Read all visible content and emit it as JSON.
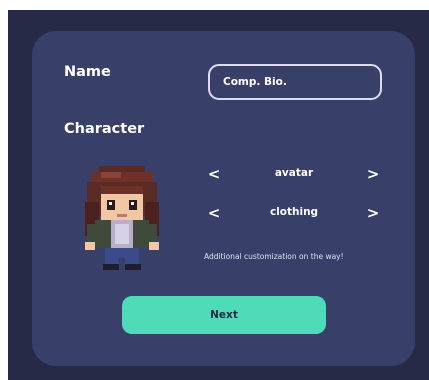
{
  "form": {
    "name_label": "Name",
    "name_value": "Comp. Bio.",
    "character_label": "Character"
  },
  "selectors": {
    "avatar": {
      "label": "avatar",
      "prev_icon": "chevron-left-icon",
      "next_icon": "chevron-right-icon",
      "prev_glyph": "<",
      "next_glyph": ">"
    },
    "clothing": {
      "label": "clothing",
      "prev_icon": "chevron-left-icon",
      "next_icon": "chevron-right-icon",
      "prev_glyph": "<",
      "next_glyph": ">"
    }
  },
  "hint": "Additional customization on the way!",
  "actions": {
    "next_label": "Next"
  },
  "colors": {
    "background": "#262a47",
    "card": "#383f69",
    "accent": "#4fdab8",
    "input_border": "#dcdcf0",
    "text": "#ffffff"
  }
}
